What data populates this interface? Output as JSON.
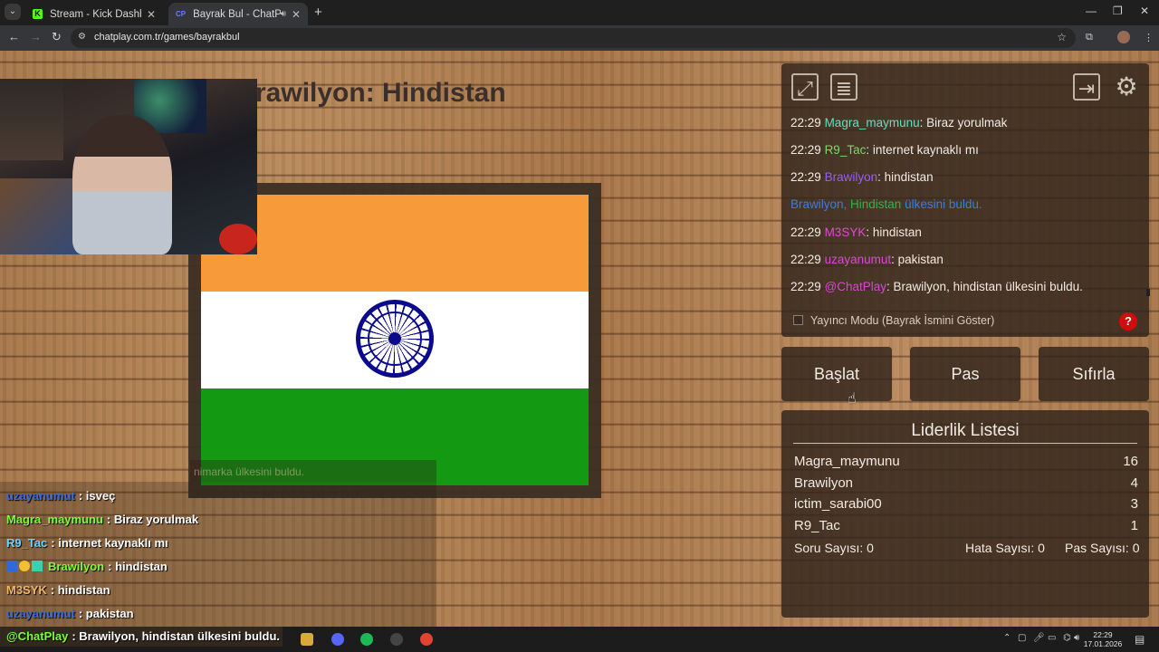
{
  "browser": {
    "tabs": [
      {
        "title": "Stream - Kick Dashboard"
      },
      {
        "title": "Bayrak Bul - ChatPlay",
        "favicon": "CP"
      }
    ],
    "url": "chatplay.com.tr/games/bayrakbul"
  },
  "game": {
    "headline": "rawilyon: Hindistan",
    "flag_colors": {
      "top": "#f79a3a",
      "middle": "#ffffff",
      "bottom": "#149a12",
      "wheel": "#0a0a8a"
    },
    "ghost_notice": "nimarka ülkesini buldu."
  },
  "overlay_chat": [
    {
      "user": "uzayanumut",
      "text": ": isveç",
      "color": "#3b6bd8"
    },
    {
      "user": "Magra_maymunu",
      "text": ": Biraz yorulmak",
      "color": "#7dfc3a"
    },
    {
      "user": "R9_Tac",
      "text": ": internet kaynaklı mı",
      "color": "#6ed4ff"
    },
    {
      "user": "Brawilyon",
      "text": ": hindistan",
      "color": "#7dfc3a",
      "badges": true
    },
    {
      "user": "M3SYK",
      "text": ": hindistan",
      "color": "#f0b56a"
    },
    {
      "user": "uzayanumut",
      "text": ": pakistan",
      "color": "#3b6bd8"
    },
    {
      "user": "@ChatPlay",
      "text": ": Brawilyon, hindistan ülkesini buldu.",
      "color": "#7dfc3a"
    }
  ],
  "chat_panel": {
    "messages": [
      {
        "time": "22:29",
        "user": "Magra_maymunu",
        "color": "#5fe0c0",
        "text": ": Biraz yorulmak"
      },
      {
        "time": "22:29",
        "user": "R9_Tac",
        "color": "#7ad96b",
        "text": ": internet kaynaklı mı"
      },
      {
        "time": "22:29",
        "user": "Brawilyon",
        "color": "#9b5cff",
        "text": ": hindistan"
      },
      {
        "system": true,
        "user": "Brawilyon, ",
        "country": "Hindistan",
        "text": " ülkesini buldu."
      },
      {
        "time": "22:29",
        "user": "M3SYK",
        "color": "#e04ad0",
        "text": ": hindistan"
      },
      {
        "time": "22:29",
        "user": "uzayanumut",
        "color": "#d64ad0",
        "text": ": pakistan"
      },
      {
        "time": "22:29",
        "user": "@ChatPlay",
        "color": "#d64ad0",
        "text": ": Brawilyon, hindistan ülkesini buldu."
      }
    ],
    "streamer_mode_label": "Yayıncı Modu (Bayrak İsmini Göster)",
    "help": "?"
  },
  "buttons": {
    "start": "Başlat",
    "pass": "Pas",
    "reset": "Sıfırla"
  },
  "leaderboard": {
    "title": "Liderlik Listesi",
    "rows": [
      {
        "name": "Magra_maymunu",
        "score": "16"
      },
      {
        "name": "Brawilyon",
        "score": "4"
      },
      {
        "name": "ictim_sarabi00",
        "score": "3"
      },
      {
        "name": "R9_Tac",
        "score": "1"
      }
    ],
    "stats": {
      "questions": "Soru Sayısı: 0",
      "errors": "Hata Sayısı: 0",
      "passes": "Pas Sayısı: 0"
    }
  },
  "taskbar": {
    "time": "22:29",
    "date": "17.01.2026"
  },
  "colors": {
    "system_blue": "#3b7ddd",
    "country_green": "#31b44b",
    "help_red": "#d10c0c"
  }
}
